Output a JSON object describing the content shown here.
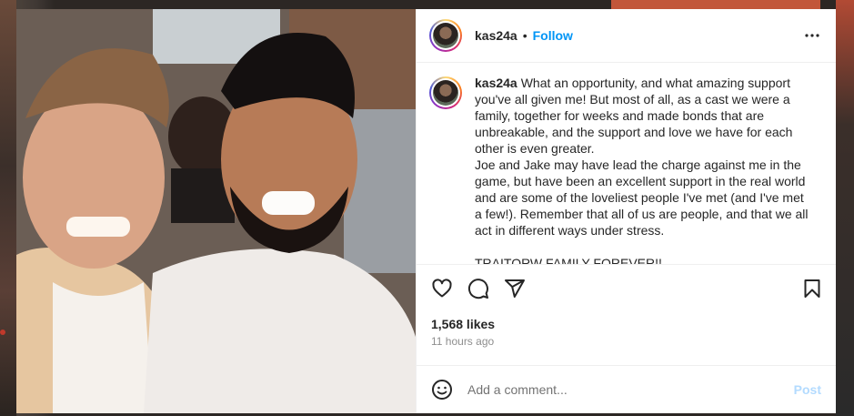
{
  "post": {
    "username": "kas24a",
    "separator": "•",
    "follow_label": "Follow",
    "more_label": "•••",
    "caption_username": "kas24a",
    "caption_text": "What an opportunity, and what amazing support you've all given me! But most of all, as a cast we were a family, together for weeks and made bonds that are unbreakable, and the support and love we have for each other is even greater.\nJoe and Jake may have lead the charge against me in the game, but have been an excellent support in the real world and are some of the loveliest people I've met (and I've met a few!). Remember that all of us are people, and that we all act in different ways under stress.\n\nTRAITORW FAMILY FOREVER!!",
    "likes": "1,568 likes",
    "timestamp": "11 hours ago"
  },
  "actions": {
    "like_icon": "heart-icon",
    "comment_icon": "comment-icon",
    "share_icon": "share-icon",
    "save_icon": "bookmark-icon"
  },
  "comment": {
    "placeholder": "Add a comment...",
    "post_label": "Post",
    "emoji_icon": "emoji-icon"
  },
  "colors": {
    "accent": "#0095f6",
    "post_disabled": "#b3dbff",
    "text": "#262626",
    "muted": "#8e8e8e"
  }
}
